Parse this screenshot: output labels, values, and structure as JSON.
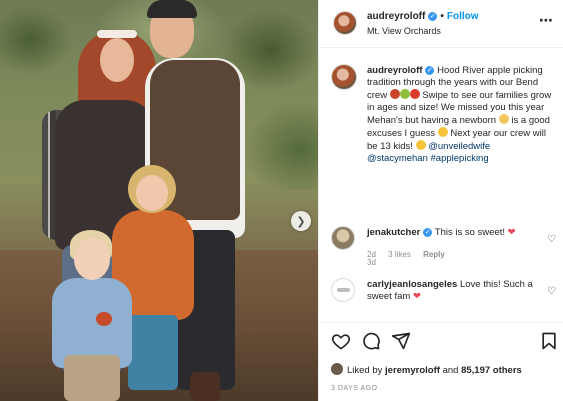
{
  "header": {
    "username": "audreyroloff",
    "follow_label": "Follow",
    "location": "Mt. View Orchards",
    "separator": "•"
  },
  "caption": {
    "username": "audreyroloff",
    "text_1": "Hood River apple picking tradition through the years with our Bend crew",
    "text_2": "Swipe to see our families grow in ages and size! We missed you this year Mehan's but having a newborn",
    "text_3": "is a good excuses I guess",
    "text_4": "Next year our crew will be 13 kids!",
    "mention_1": "@unveiledwife",
    "mention_2": "@stacymehan",
    "hashtag": "#applepicking",
    "time": "3d"
  },
  "comments": [
    {
      "username": "jenakutcher",
      "text": "This is so sweet!",
      "age": "2d",
      "likes": "3 likes",
      "reply_label": "Reply"
    },
    {
      "username": "carlyjeanlosangeles",
      "text": "Love this! Such a sweet fam",
      "age": "",
      "likes": "",
      "reply_label": ""
    }
  ],
  "likes": {
    "prefix": "Liked by",
    "user": "jeremyroloff",
    "connector": "and",
    "count_text": "85,197 others"
  },
  "posted_ago": "3 DAYS AGO",
  "icons": [
    "like-heart-icon",
    "comment-icon",
    "share-icon",
    "save-bookmark-icon",
    "more-options-icon",
    "verified-badge-icon",
    "next-arrow-icon"
  ],
  "colors": {
    "accent_blue": "#0095f6",
    "verified_blue": "#3897f0",
    "heart_red": "#ed4956",
    "muted_text": "#8e8e8e"
  }
}
